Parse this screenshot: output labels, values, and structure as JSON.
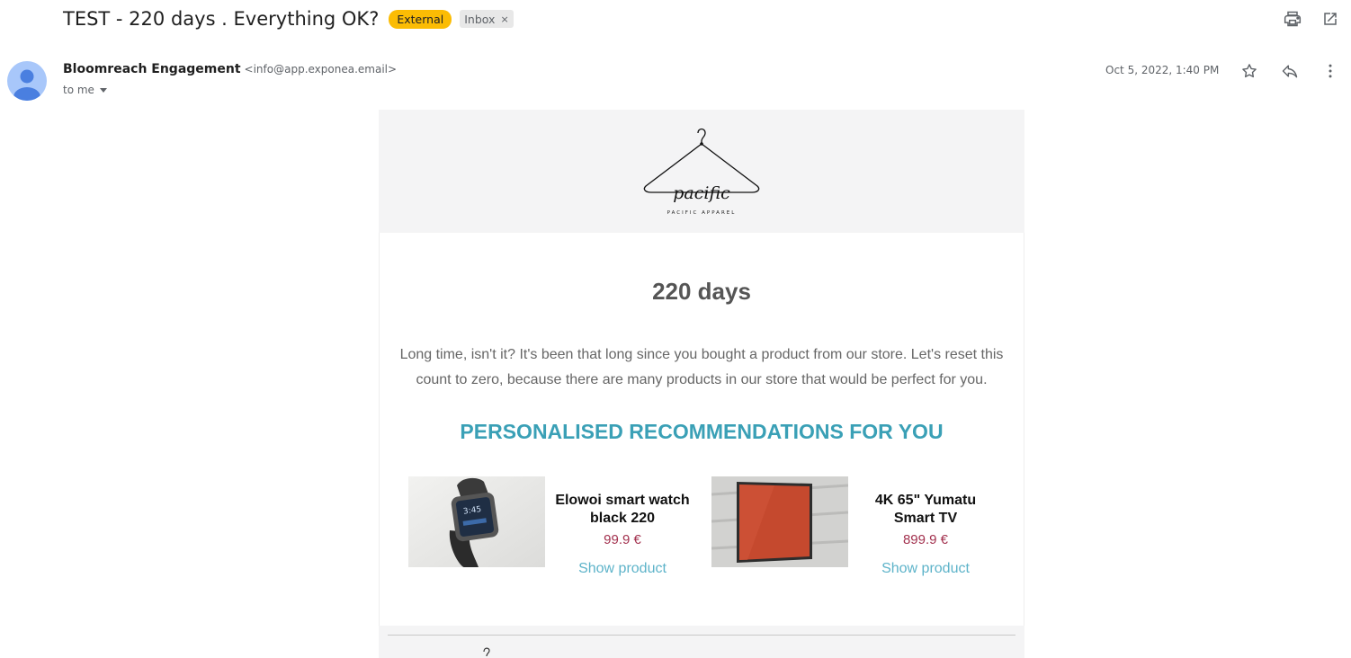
{
  "subject": "TEST - 220 days . Everything OK?",
  "labels": {
    "external": "External",
    "inbox": "Inbox",
    "inbox_remove": "×"
  },
  "top_actions": {
    "print": "print-icon",
    "open_new_window": "open-in-new-icon"
  },
  "sender": {
    "name": "Bloomreach Engagement",
    "email": "<info@app.exponea.email>",
    "to": "to me"
  },
  "date": "Oct 5, 2022, 1:40 PM",
  "message_actions": [
    "star-icon",
    "reply-icon",
    "more-vert-icon"
  ],
  "email": {
    "brand": {
      "logo_script": "pacific",
      "subtitle": "PACIFIC APPAREL"
    },
    "headline": "220 days",
    "intro": "Long time, isn't it? It's been that long since you bought a product from our store. Let's reset this count to zero, because there are many products in our store that would be perfect for you.",
    "recommendations_title": "PERSONALISED RECOMMENDATIONS FOR YOU",
    "products": [
      {
        "name": "Elowoi smart watch black 220",
        "price": "99.9 €",
        "link": "Show product",
        "watch_time": "3:45"
      },
      {
        "name": "4K 65\" Yumatu Smart TV",
        "price": "899.9 €",
        "link": "Show product"
      }
    ]
  },
  "colors": {
    "external_badge": "#fbbc04",
    "accent": "#3aa0b6",
    "price": "#a3324f",
    "link": "#5db3c9",
    "header_bg": "#f4f4f5"
  }
}
